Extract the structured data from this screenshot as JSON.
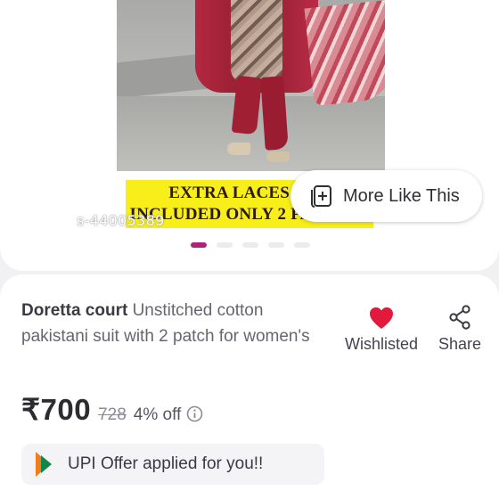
{
  "product_image": {
    "banner_lines": [
      "EXTRA LACES AND",
      "INCLUDED ONLY 2 PATCHES"
    ],
    "watermark": "s-44005389"
  },
  "more_like_this": {
    "label": "More Like This",
    "icon": "add-collection-icon"
  },
  "carousel": {
    "total": 5,
    "active_index": 0
  },
  "product": {
    "brand": "Doretta court",
    "name": " Unstitched cotton pakistani suit with 2 patch for women's"
  },
  "actions": {
    "wishlist_label": "Wishlisted",
    "wishlist_icon": "heart-icon",
    "share_label": "Share",
    "share_icon": "share-icon"
  },
  "price": {
    "current": "₹700",
    "mrp": "728",
    "discount": "4% off",
    "info_icon": "info-icon"
  },
  "offer": {
    "text": "UPI Offer applied for you!!",
    "icon": "upi-icon"
  },
  "colors": {
    "accent": "#b0237b",
    "heart": "#e2193c",
    "banner": "#f7ee1a"
  }
}
